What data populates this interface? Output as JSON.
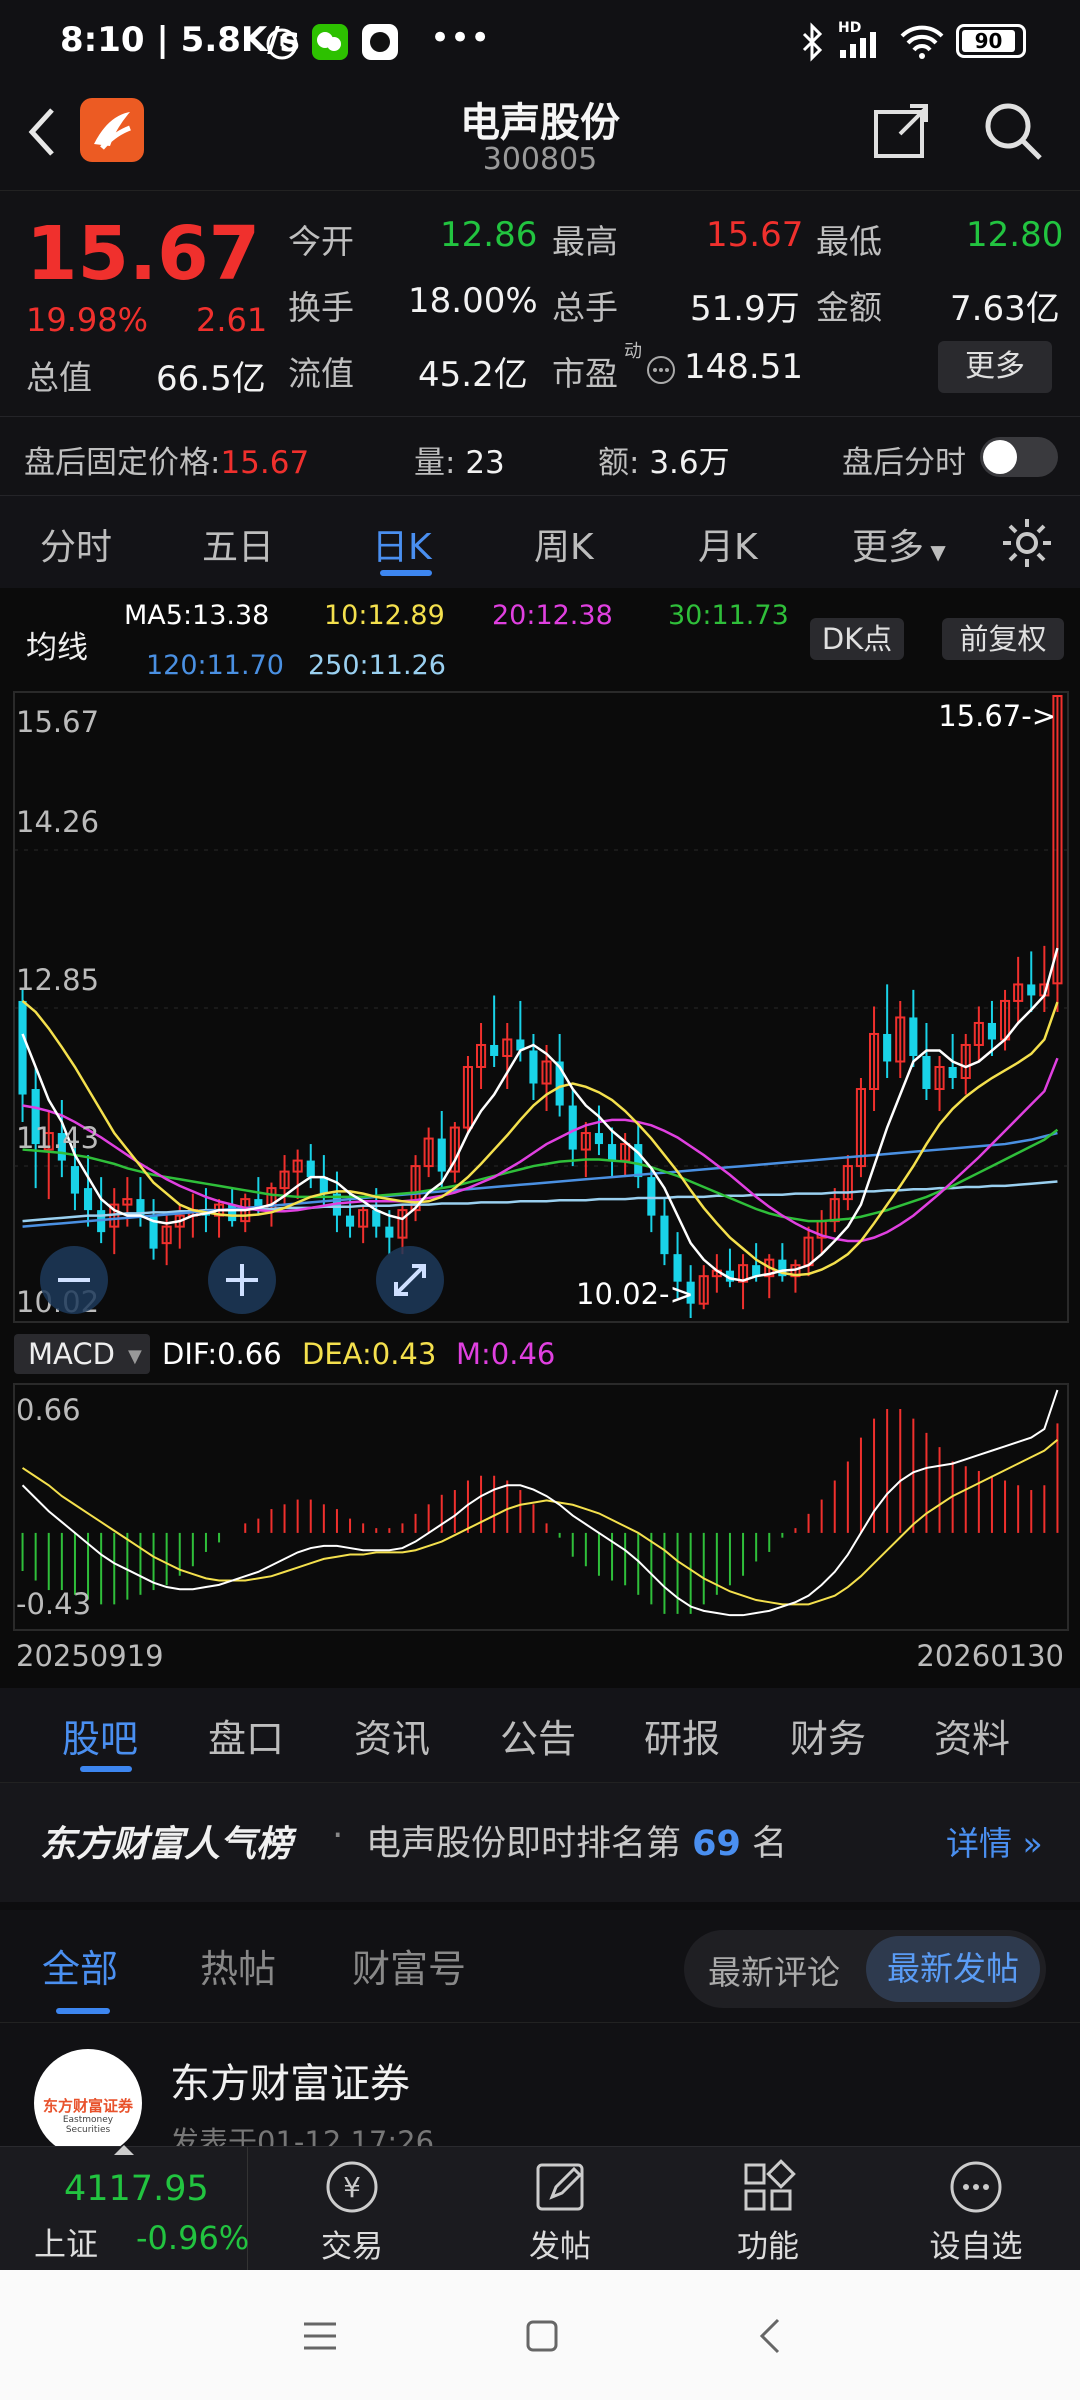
{
  "status_bar": {
    "time": "8:10",
    "speed": "5.8K/s",
    "battery": "90",
    "hd": "HD"
  },
  "header": {
    "title": "电声股份",
    "code": "300805"
  },
  "quote": {
    "price": "15.67",
    "change_pct": "19.98%",
    "change_amt": "2.61",
    "open_label": "今开",
    "open": "12.86",
    "high_label": "最高",
    "high": "15.67",
    "low_label": "最低",
    "low": "12.80",
    "turnover_label": "换手",
    "turnover": "18.00%",
    "volume_label": "总手",
    "volume": "51.9万",
    "amount_label": "金额",
    "amount": "7.63亿",
    "mktcap_label": "总值",
    "mktcap": "66.5亿",
    "float_label": "流值",
    "float": "45.2亿",
    "pe_label": "市盈",
    "pe_sup": "动",
    "pe": "148.51",
    "more_label": "更多"
  },
  "after_hours": {
    "price_label": "盘后固定价格:",
    "price": "15.67",
    "vol_label": "量:",
    "vol": "23",
    "amt_label": "额:",
    "amt": "3.6万",
    "timeshare_label": "盘后分时"
  },
  "kline_tabs": [
    "分时",
    "五日",
    "日K",
    "周K",
    "月K",
    "更多"
  ],
  "ma": {
    "title": "均线",
    "ma5": "MA5:13.38",
    "ma10": "10:12.89",
    "ma20": "20:12.38",
    "ma30": "30:11.73",
    "ma120": "120:11.70",
    "ma250": "250:11.26",
    "dk_label": "DK点",
    "adjust_label": "前复权"
  },
  "chart": {
    "y_max": "15.67",
    "y_2": "14.26",
    "y_3": "12.85",
    "y_4": "11.43",
    "y_min": "10.02",
    "hi_marker": "15.67->",
    "lo_marker": "10.02->"
  },
  "macd": {
    "selector": "MACD",
    "dif": "DIF:0.66",
    "dea": "DEA:0.43",
    "m": "M:0.46",
    "y_max": "0.66",
    "y_min": "-0.43",
    "date_start": "20250919",
    "date_end": "20260130"
  },
  "colors": {
    "up": "#f0302d",
    "down": "#19d3e8",
    "ma5": "#ffffff",
    "ma10": "#f4e04d",
    "ma20": "#e040e0",
    "ma30": "#2fbf3a",
    "ma120": "#4a90e2",
    "ma250": "#9ad0f0",
    "accent": "#3d86f0"
  },
  "chart_data": {
    "type": "candlestick",
    "y_range": [
      10.02,
      15.67
    ],
    "macd_range": [
      -0.43,
      0.66
    ],
    "candles": [
      [
        12.9,
        13.0,
        11.8,
        12.05
      ],
      [
        12.1,
        12.3,
        11.2,
        11.6
      ],
      [
        11.55,
        11.9,
        11.1,
        11.7
      ],
      [
        11.7,
        12.0,
        11.3,
        11.45
      ],
      [
        11.4,
        11.7,
        11.0,
        11.15
      ],
      [
        11.2,
        11.5,
        10.85,
        11.0
      ],
      [
        11.0,
        11.3,
        10.7,
        10.8
      ],
      [
        10.85,
        11.2,
        10.6,
        11.05
      ],
      [
        11.05,
        11.3,
        10.85,
        11.1
      ],
      [
        11.1,
        11.3,
        10.85,
        10.95
      ],
      [
        10.95,
        11.1,
        10.55,
        10.65
      ],
      [
        10.7,
        10.95,
        10.5,
        10.85
      ],
      [
        10.85,
        11.05,
        10.65,
        10.95
      ],
      [
        10.95,
        11.15,
        10.75,
        11.0
      ],
      [
        11.0,
        11.2,
        10.8,
        10.95
      ],
      [
        10.95,
        11.1,
        10.75,
        11.05
      ],
      [
        11.05,
        11.2,
        10.85,
        10.9
      ],
      [
        10.9,
        11.15,
        10.8,
        11.1
      ],
      [
        11.1,
        11.3,
        10.95,
        11.0
      ],
      [
        11.0,
        11.25,
        10.85,
        11.2
      ],
      [
        11.2,
        11.5,
        11.05,
        11.35
      ],
      [
        11.35,
        11.55,
        11.1,
        11.45
      ],
      [
        11.45,
        11.6,
        11.2,
        11.3
      ],
      [
        11.3,
        11.5,
        11.05,
        11.15
      ],
      [
        11.15,
        11.35,
        10.8,
        10.95
      ],
      [
        10.95,
        11.15,
        10.75,
        10.85
      ],
      [
        10.85,
        11.05,
        10.7,
        11.0
      ],
      [
        11.0,
        11.2,
        10.75,
        10.85
      ],
      [
        10.85,
        11.0,
        10.6,
        10.75
      ],
      [
        10.75,
        11.05,
        10.6,
        11.0
      ],
      [
        11.0,
        11.5,
        10.9,
        11.4
      ],
      [
        11.4,
        11.75,
        11.3,
        11.65
      ],
      [
        11.65,
        11.9,
        11.2,
        11.35
      ],
      [
        11.35,
        11.8,
        11.25,
        11.75
      ],
      [
        11.75,
        12.4,
        11.7,
        12.3
      ],
      [
        12.3,
        12.7,
        12.1,
        12.5
      ],
      [
        12.5,
        12.95,
        12.3,
        12.4
      ],
      [
        12.4,
        12.7,
        12.1,
        12.55
      ],
      [
        12.55,
        12.9,
        12.35,
        12.45
      ],
      [
        12.45,
        12.6,
        12.0,
        12.15
      ],
      [
        12.15,
        12.5,
        11.9,
        12.35
      ],
      [
        12.35,
        12.6,
        11.85,
        11.95
      ],
      [
        11.95,
        12.1,
        11.4,
        11.55
      ],
      [
        11.55,
        11.8,
        11.3,
        11.7
      ],
      [
        11.7,
        11.95,
        11.5,
        11.6
      ],
      [
        11.6,
        11.75,
        11.3,
        11.45
      ],
      [
        11.45,
        11.7,
        11.3,
        11.6
      ],
      [
        11.6,
        11.8,
        11.2,
        11.3
      ],
      [
        11.3,
        11.4,
        10.8,
        10.95
      ],
      [
        10.95,
        11.1,
        10.5,
        10.6
      ],
      [
        10.6,
        10.8,
        10.2,
        10.35
      ],
      [
        10.35,
        10.5,
        10.02,
        10.15
      ],
      [
        10.15,
        10.5,
        10.1,
        10.4
      ],
      [
        10.4,
        10.6,
        10.25,
        10.45
      ],
      [
        10.45,
        10.65,
        10.3,
        10.35
      ],
      [
        10.35,
        10.6,
        10.1,
        10.5
      ],
      [
        10.5,
        10.7,
        10.35,
        10.4
      ],
      [
        10.4,
        10.6,
        10.2,
        10.55
      ],
      [
        10.55,
        10.7,
        10.35,
        10.4
      ],
      [
        10.4,
        10.55,
        10.25,
        10.5
      ],
      [
        10.5,
        10.85,
        10.4,
        10.75
      ],
      [
        10.75,
        11.0,
        10.6,
        10.9
      ],
      [
        10.9,
        11.2,
        10.8,
        11.1
      ],
      [
        11.1,
        11.5,
        11.0,
        11.4
      ],
      [
        11.4,
        12.2,
        11.3,
        12.1
      ],
      [
        12.1,
        12.85,
        11.9,
        12.6
      ],
      [
        12.6,
        13.05,
        12.2,
        12.35
      ],
      [
        12.35,
        12.9,
        12.2,
        12.75
      ],
      [
        12.75,
        13.0,
        12.3,
        12.4
      ],
      [
        12.4,
        12.7,
        12.0,
        12.1
      ],
      [
        12.1,
        12.4,
        11.9,
        12.3
      ],
      [
        12.3,
        12.6,
        12.1,
        12.2
      ],
      [
        12.2,
        12.6,
        12.05,
        12.5
      ],
      [
        12.5,
        12.85,
        12.35,
        12.7
      ],
      [
        12.7,
        12.9,
        12.4,
        12.55
      ],
      [
        12.55,
        13.0,
        12.45,
        12.9
      ],
      [
        12.9,
        13.3,
        12.7,
        13.05
      ],
      [
        13.05,
        13.35,
        12.8,
        12.95
      ],
      [
        12.95,
        13.4,
        12.8,
        13.05
      ],
      [
        13.06,
        15.67,
        12.8,
        15.67
      ]
    ],
    "ma5": [
      12.6,
      12.3,
      12.0,
      11.8,
      11.5,
      11.3,
      11.1,
      11.0,
      10.95,
      10.95,
      10.9,
      10.88,
      10.9,
      10.95,
      10.97,
      11.0,
      11.0,
      11.0,
      11.02,
      11.05,
      11.13,
      11.22,
      11.3,
      11.3,
      11.25,
      11.15,
      11.08,
      11.0,
      10.95,
      10.92,
      11.02,
      11.16,
      11.25,
      11.45,
      11.7,
      11.9,
      12.05,
      12.25,
      12.45,
      12.5,
      12.42,
      12.3,
      12.1,
      11.95,
      11.85,
      11.72,
      11.62,
      11.52,
      11.38,
      11.2,
      10.95,
      10.7,
      10.55,
      10.45,
      10.38,
      10.36,
      10.4,
      10.42,
      10.45,
      10.46,
      10.5,
      10.6,
      10.72,
      10.85,
      11.05,
      11.4,
      11.75,
      12.05,
      12.35,
      12.45,
      12.45,
      12.35,
      12.3,
      12.35,
      12.45,
      12.55,
      12.7,
      12.82,
      12.95,
      13.38
    ],
    "ma10": [
      12.9,
      12.8,
      12.65,
      12.48,
      12.3,
      12.1,
      11.9,
      11.7,
      11.55,
      11.4,
      11.25,
      11.15,
      11.05,
      11.0,
      10.98,
      10.96,
      10.95,
      10.95,
      10.96,
      10.98,
      11.02,
      11.07,
      11.12,
      11.15,
      11.17,
      11.17,
      11.15,
      11.12,
      11.1,
      11.08,
      11.07,
      11.08,
      11.12,
      11.2,
      11.3,
      11.42,
      11.55,
      11.68,
      11.82,
      11.95,
      12.05,
      12.12,
      12.15,
      12.12,
      12.07,
      12.0,
      11.9,
      11.78,
      11.65,
      11.5,
      11.35,
      11.18,
      11.02,
      10.88,
      10.75,
      10.65,
      10.55,
      10.48,
      10.43,
      10.41,
      10.42,
      10.46,
      10.52,
      10.6,
      10.72,
      10.88,
      11.05,
      11.22,
      11.4,
      11.6,
      11.78,
      11.92,
      12.03,
      12.12,
      12.2,
      12.27,
      12.34,
      12.42,
      12.55,
      12.89
    ],
    "ma20": [
      11.95,
      11.93,
      11.9,
      11.86,
      11.8,
      11.73,
      11.66,
      11.58,
      11.5,
      11.42,
      11.35,
      11.28,
      11.22,
      11.17,
      11.12,
      11.08,
      11.05,
      11.02,
      11.0,
      10.99,
      10.99,
      11.0,
      11.02,
      11.04,
      11.06,
      11.07,
      11.08,
      11.08,
      11.08,
      11.08,
      11.09,
      11.11,
      11.13,
      11.16,
      11.2,
      11.25,
      11.3,
      11.37,
      11.44,
      11.52,
      11.6,
      11.66,
      11.72,
      11.77,
      11.8,
      11.82,
      11.82,
      11.8,
      11.77,
      11.72,
      11.66,
      11.58,
      11.5,
      11.41,
      11.32,
      11.22,
      11.12,
      11.03,
      10.95,
      10.88,
      10.82,
      10.77,
      10.74,
      10.72,
      10.72,
      10.75,
      10.8,
      10.87,
      10.95,
      11.05,
      11.15,
      11.26,
      11.37,
      11.48,
      11.6,
      11.72,
      11.84,
      11.96,
      12.08,
      12.38
    ],
    "ma30": [
      11.55,
      11.54,
      11.53,
      11.52,
      11.5,
      11.48,
      11.45,
      11.42,
      11.38,
      11.35,
      11.32,
      11.3,
      11.28,
      11.26,
      11.24,
      11.22,
      11.2,
      11.18,
      11.16,
      11.14,
      11.13,
      11.12,
      11.12,
      11.12,
      11.12,
      11.12,
      11.12,
      11.13,
      11.14,
      11.15,
      11.16,
      11.18,
      11.2,
      11.22,
      11.25,
      11.28,
      11.31,
      11.34,
      11.37,
      11.4,
      11.42,
      11.44,
      11.45,
      11.46,
      11.46,
      11.45,
      11.44,
      11.42,
      11.39,
      11.35,
      11.31,
      11.26,
      11.21,
      11.16,
      11.11,
      11.06,
      11.01,
      10.97,
      10.94,
      10.92,
      10.9,
      10.9,
      10.91,
      10.92,
      10.94,
      10.97,
      11.0,
      11.04,
      11.08,
      11.12,
      11.17,
      11.22,
      11.28,
      11.34,
      11.4,
      11.46,
      11.52,
      11.58,
      11.64,
      11.73
    ],
    "ma120": [
      10.85,
      10.86,
      10.87,
      10.88,
      10.89,
      10.9,
      10.91,
      10.92,
      10.93,
      10.94,
      10.95,
      10.96,
      10.97,
      10.98,
      10.99,
      11.0,
      11.01,
      11.02,
      11.03,
      11.04,
      11.05,
      11.06,
      11.07,
      11.08,
      11.09,
      11.1,
      11.11,
      11.12,
      11.13,
      11.14,
      11.15,
      11.16,
      11.17,
      11.18,
      11.19,
      11.2,
      11.21,
      11.22,
      11.23,
      11.24,
      11.25,
      11.26,
      11.27,
      11.28,
      11.29,
      11.3,
      11.31,
      11.32,
      11.33,
      11.34,
      11.35,
      11.36,
      11.37,
      11.38,
      11.39,
      11.4,
      11.41,
      11.42,
      11.43,
      11.44,
      11.45,
      11.46,
      11.47,
      11.48,
      11.49,
      11.5,
      11.51,
      11.52,
      11.53,
      11.54,
      11.55,
      11.56,
      11.57,
      11.58,
      11.59,
      11.6,
      11.62,
      11.64,
      11.67,
      11.7
    ],
    "ma250": [
      10.9,
      10.91,
      10.92,
      10.93,
      10.94,
      10.95,
      10.95,
      10.96,
      10.97,
      10.97,
      10.98,
      10.98,
      10.99,
      10.99,
      11.0,
      11.0,
      11.0,
      11.01,
      11.01,
      11.01,
      11.02,
      11.02,
      11.02,
      11.03,
      11.03,
      11.03,
      11.04,
      11.04,
      11.04,
      11.05,
      11.05,
      11.05,
      11.06,
      11.06,
      11.06,
      11.07,
      11.07,
      11.07,
      11.08,
      11.08,
      11.08,
      11.09,
      11.09,
      11.09,
      11.1,
      11.1,
      11.1,
      11.11,
      11.11,
      11.11,
      11.12,
      11.12,
      11.12,
      11.13,
      11.13,
      11.13,
      11.14,
      11.14,
      11.14,
      11.15,
      11.15,
      11.15,
      11.16,
      11.16,
      11.17,
      11.17,
      11.18,
      11.18,
      11.19,
      11.19,
      11.2,
      11.2,
      11.21,
      11.21,
      11.22,
      11.22,
      11.23,
      11.24,
      11.25,
      11.26
    ],
    "dif": [
      0.22,
      0.16,
      0.1,
      0.05,
      0.0,
      -0.05,
      -0.1,
      -0.14,
      -0.17,
      -0.2,
      -0.23,
      -0.25,
      -0.26,
      -0.26,
      -0.25,
      -0.24,
      -0.22,
      -0.2,
      -0.18,
      -0.15,
      -0.12,
      -0.09,
      -0.07,
      -0.06,
      -0.06,
      -0.07,
      -0.08,
      -0.08,
      -0.08,
      -0.07,
      -0.04,
      0.0,
      0.04,
      0.08,
      0.13,
      0.17,
      0.2,
      0.22,
      0.22,
      0.2,
      0.17,
      0.13,
      0.08,
      0.04,
      0.0,
      -0.04,
      -0.08,
      -0.13,
      -0.19,
      -0.25,
      -0.3,
      -0.34,
      -0.36,
      -0.37,
      -0.38,
      -0.38,
      -0.37,
      -0.36,
      -0.34,
      -0.32,
      -0.29,
      -0.24,
      -0.18,
      -0.1,
      0.0,
      0.1,
      0.18,
      0.24,
      0.28,
      0.3,
      0.31,
      0.32,
      0.34,
      0.36,
      0.38,
      0.4,
      0.42,
      0.44,
      0.48,
      0.66
    ],
    "dea": [
      0.3,
      0.26,
      0.22,
      0.17,
      0.13,
      0.09,
      0.05,
      0.01,
      -0.03,
      -0.07,
      -0.11,
      -0.14,
      -0.17,
      -0.19,
      -0.21,
      -0.22,
      -0.22,
      -0.22,
      -0.21,
      -0.2,
      -0.18,
      -0.16,
      -0.14,
      -0.12,
      -0.11,
      -0.1,
      -0.1,
      -0.09,
      -0.09,
      -0.09,
      -0.08,
      -0.06,
      -0.04,
      -0.01,
      0.02,
      0.05,
      0.08,
      0.11,
      0.13,
      0.14,
      0.15,
      0.14,
      0.13,
      0.11,
      0.09,
      0.06,
      0.03,
      0.0,
      -0.04,
      -0.08,
      -0.13,
      -0.17,
      -0.21,
      -0.24,
      -0.27,
      -0.29,
      -0.31,
      -0.32,
      -0.33,
      -0.33,
      -0.33,
      -0.31,
      -0.29,
      -0.25,
      -0.2,
      -0.14,
      -0.08,
      -0.02,
      0.04,
      0.09,
      0.13,
      0.17,
      0.2,
      0.23,
      0.26,
      0.29,
      0.32,
      0.35,
      0.38,
      0.43
    ]
  },
  "bottom_tabs": [
    "股吧",
    "盘口",
    "资讯",
    "公告",
    "研报",
    "财务",
    "资料"
  ],
  "rank": {
    "brand": "东方财富人气榜",
    "text": "电声股份即时排名第",
    "rank": "69",
    "suffix": "名",
    "detail": "详情"
  },
  "filter": {
    "tabs": [
      "全部",
      "热帖",
      "财富号"
    ],
    "sort_latest_comment": "最新评论",
    "sort_latest_post": "最新发帖"
  },
  "post": {
    "author": "东方财富证券",
    "time": "发表于01-12 17:26",
    "avatar_text": "东方财富证券",
    "avatar_sub": "Eastmoney Securities"
  },
  "dock": {
    "index_value": "4117.95",
    "index_name": "上证",
    "index_change": "-0.96%",
    "trade": "交易",
    "post": "发帖",
    "func": "功能",
    "watch": "设自选"
  }
}
